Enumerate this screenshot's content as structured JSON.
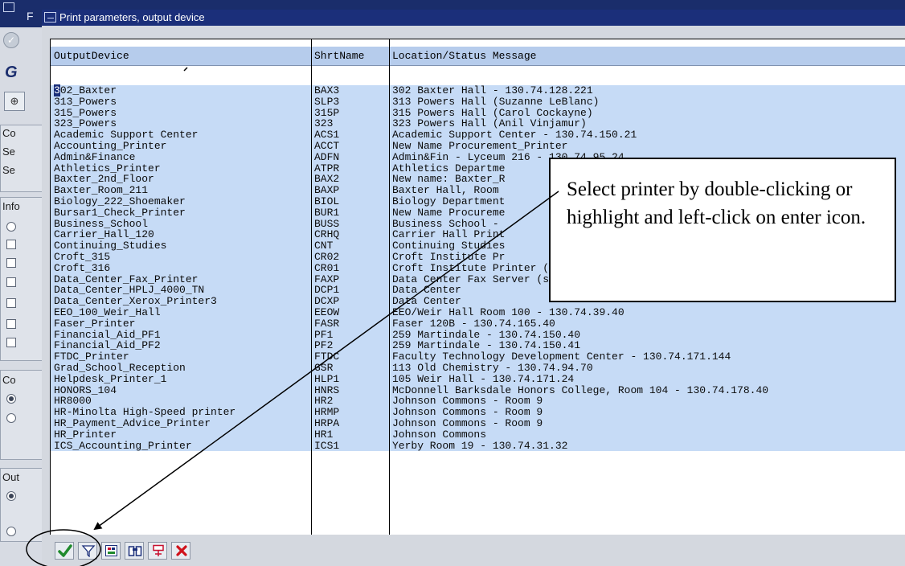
{
  "dialog": {
    "title": "Print parameters, output device"
  },
  "background": {
    "title_char": "F",
    "title_fragment": "G",
    "labels": [
      "Co",
      "Se",
      "Se",
      "Info",
      "Co",
      "Out"
    ]
  },
  "columns": {
    "output_device": "OutputDevice",
    "short_name": "ShrtName",
    "location": "Location/Status Message"
  },
  "rows": [
    [
      "302_Baxter",
      "BAX3",
      "302 Baxter Hall - 130.74.128.221"
    ],
    [
      "313_Powers",
      "SLP3",
      "313 Powers Hall (Suzanne LeBlanc)"
    ],
    [
      "315_Powers",
      "315P",
      "315 Powers Hall (Carol Cockayne)"
    ],
    [
      "323_Powers",
      "323",
      "323 Powers Hall (Anil Vinjamur)"
    ],
    [
      "Academic Support Center",
      "ACS1",
      "Academic Support Center - 130.74.150.21"
    ],
    [
      "Accounting_Printer",
      "ACCT",
      "New Name Procurement_Printer"
    ],
    [
      "Admin&Finance",
      "ADFN",
      "Admin&Fin - Lyceum 216 - 130.74.95.24"
    ],
    [
      "Athletics_Printer",
      "ATPR",
      "Athletics Departme"
    ],
    [
      "Baxter_2nd_Floor",
      "BAX2",
      "New name: Baxter_R"
    ],
    [
      "Baxter_Room_211",
      "BAXP",
      "Baxter Hall, Room"
    ],
    [
      "Biology_222_Shoemaker",
      "BIOL",
      "Biology Department"
    ],
    [
      "Bursar1_Check_Printer",
      "BUR1",
      "New Name Procureme"
    ],
    [
      "Business_School",
      "BUSS",
      "Business School -"
    ],
    [
      "Carrier_Hall_120",
      "CRHQ",
      "Carrier Hall Print"
    ],
    [
      "Continuing_Studies",
      "CNT",
      "Continuing Studies"
    ],
    [
      "Croft_315",
      "CR02",
      "Croft Institute Pr"
    ],
    [
      "Croft_316",
      "CR01",
      "Croft Institute Printer (Room 316)"
    ],
    [
      "Data_Center_Fax_Printer",
      "FAXP",
      "Data Center Fax Server (sapnt1)"
    ],
    [
      "Data_Center_HPLJ_4000_TN",
      "DCP1",
      "Data Center"
    ],
    [
      "Data_Center_Xerox_Printer3",
      "DCXP",
      "Data Center"
    ],
    [
      "EEO_100_Weir_Hall",
      "EEOW",
      "EEO/Weir Hall Room 100 - 130.74.39.40"
    ],
    [
      "Faser_Printer",
      "FASR",
      "Faser 120B - 130.74.165.40"
    ],
    [
      "Financial_Aid_PF1",
      "PF1",
      "259 Martindale - 130.74.150.40"
    ],
    [
      "Financial_Aid_PF2",
      "PF2",
      "259 Martindale - 130.74.150.41"
    ],
    [
      "FTDC_Printer",
      "FTDC",
      "Faculty Technology Development Center - 130.74.171.144"
    ],
    [
      "Grad_School_Reception",
      "GSR",
      "113 Old Chemistry - 130.74.94.70"
    ],
    [
      "Helpdesk_Printer_1",
      "HLP1",
      "105 Weir Hall - 130.74.171.24"
    ],
    [
      "HONORS_104",
      "HNRS",
      "McDonnell Barksdale Honors College, Room 104 - 130.74.178.40"
    ],
    [
      "HR8000",
      "HR2",
      "Johnson Commons - Room 9"
    ],
    [
      "HR-Minolta High-Speed printer",
      "HRMP",
      "Johnson Commons - Room 9"
    ],
    [
      "HR_Payment_Advice_Printer",
      "HRPA",
      "Johnson Commons - Room 9"
    ],
    [
      "HR_Printer",
      "HR1",
      "Johnson Commons"
    ],
    [
      "ICS_Accounting_Printer",
      "ICS1",
      "Yerby Room 19 - 130.74.31.32"
    ]
  ],
  "toolbar": {
    "icons": [
      "check-icon",
      "filter-icon",
      "select-icon",
      "find-icon",
      "sort-icon",
      "cancel-icon"
    ]
  },
  "annotation": {
    "callout_text": "Select printer by double-clicking or highlight and left-click on enter icon."
  },
  "colors": {
    "title_bar": "#1b2f7a",
    "row_highlight": "#c6dbf6",
    "header": "#b6ccec",
    "dialog_bg": "#d4d8df"
  }
}
